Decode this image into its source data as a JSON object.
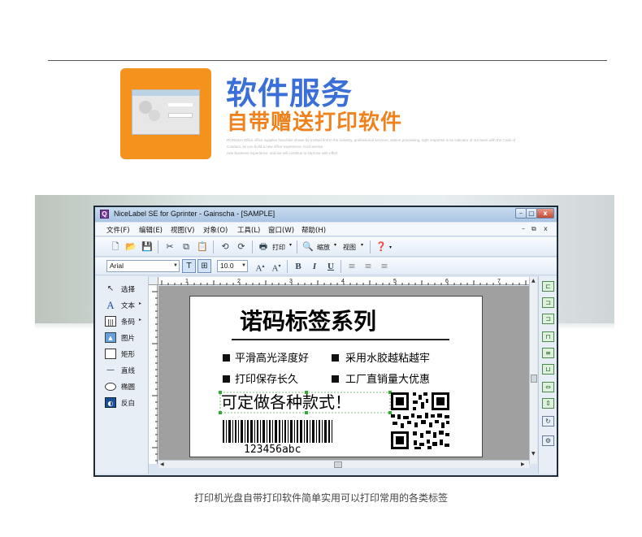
{
  "promo": {
    "headline": "软件服务",
    "subheadline": "自带赠送打印软件",
    "fine_print": [
      "RONGDA Office office supplies franchise shows by trusted first in the industry, professional services, station processing, right response is an indicator of our team with the Code of",
      "Conduct, as you build a new office experience, trust service",
      "new business experience, and we will continue to improve with effort"
    ]
  },
  "window": {
    "title": "NiceLabel SE for Gprinter - Gainscha - [SAMPLE]",
    "app_icon": "Q",
    "controls": {
      "minimize": "–",
      "maximize": "▢",
      "close": "x"
    },
    "menu": [
      "文件(F)",
      "编辑(E)",
      "视图(V)",
      "对象(O)",
      "工具(L)",
      "窗口(W)",
      "帮助(H)"
    ],
    "mdi_controls": [
      "–",
      "⧉",
      "x"
    ],
    "toolbar": {
      "print_label": "打印",
      "zoom_label": "缩放",
      "view_label": "视图"
    },
    "format": {
      "font_name": "Arial",
      "font_size": "10.0"
    },
    "tools": [
      {
        "label": "选择",
        "icon": "pointer-icon"
      },
      {
        "label": "文本",
        "icon": "text-icon"
      },
      {
        "label": "条码",
        "icon": "barcode-icon"
      },
      {
        "label": "图片",
        "icon": "picture-icon"
      },
      {
        "label": "矩形",
        "icon": "rectangle-icon"
      },
      {
        "label": "直线",
        "icon": "line-icon"
      },
      {
        "label": "椭圆",
        "icon": "ellipse-icon"
      },
      {
        "label": "反白",
        "icon": "inverse-icon"
      }
    ],
    "ruler_numbers": [
      "1",
      "2",
      "3",
      "4",
      "5",
      "6",
      "7"
    ]
  },
  "label_content": {
    "title": "诺码标签系列",
    "feature_1": "平滑高光泽度好",
    "feature_2": "采用水胶越粘越牢",
    "feature_3": "打印保存长久",
    "feature_4": "工厂直销量大优惠",
    "slogan": "可定做各种款式！",
    "barcode_text": "123456abc"
  },
  "caption": "打印机光盘自带打印软件简单实用可以打印常用的各类标签",
  "colors": {
    "headline": "#3b6fd8",
    "accent_orange": "#f5921e",
    "window_frame": "#1e2b38"
  }
}
